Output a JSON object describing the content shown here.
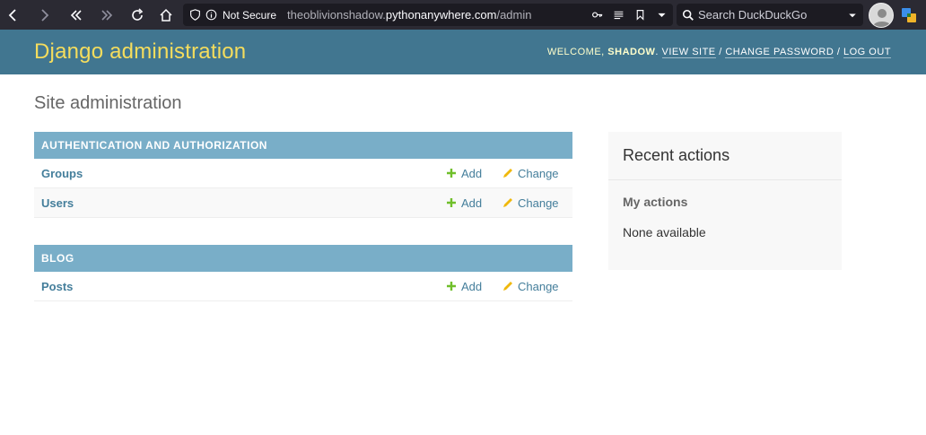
{
  "browser": {
    "security_label": "Not Secure",
    "url_prefix": "theoblivionshadow.",
    "url_domain": "pythonanywhere.com",
    "url_path": "/admin",
    "search_placeholder": "Search DuckDuckGo"
  },
  "header": {
    "branding": "Django administration",
    "welcome": "WELCOME,",
    "username": "SHADOW",
    "view_site": "VIEW SITE",
    "change_password": "CHANGE PASSWORD",
    "log_out": "LOG OUT"
  },
  "page": {
    "title": "Site administration"
  },
  "modules": [
    {
      "caption": "AUTHENTICATION AND AUTHORIZATION",
      "rows": [
        {
          "name": "Groups",
          "add": "Add",
          "change": "Change"
        },
        {
          "name": "Users",
          "add": "Add",
          "change": "Change"
        }
      ]
    },
    {
      "caption": "BLOG",
      "rows": [
        {
          "name": "Posts",
          "add": "Add",
          "change": "Change"
        }
      ]
    }
  ],
  "recent_actions": {
    "title": "Recent actions",
    "subtitle": "My actions",
    "empty": "None available"
  },
  "colors": {
    "header_bg": "#417690",
    "branding": "#f5dd5d",
    "caption_bg": "#79aec8",
    "link": "#447e9b",
    "add_green": "#70bf2b",
    "change_yellow": "#efb80b"
  }
}
